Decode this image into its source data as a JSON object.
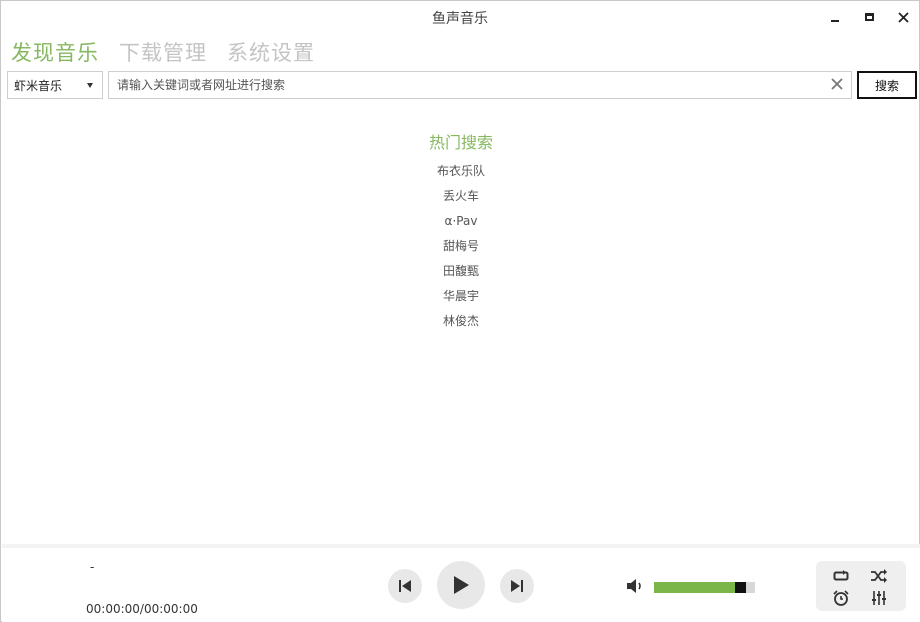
{
  "window": {
    "title": "鱼声音乐"
  },
  "nav": {
    "tabs": [
      {
        "label": "发现音乐",
        "active": true
      },
      {
        "label": "下载管理",
        "active": false
      },
      {
        "label": "系统设置",
        "active": false
      }
    ]
  },
  "search": {
    "source": "虾米音乐",
    "placeholder": "请输入关键词或者网址进行搜索",
    "value": "",
    "button_label": "搜索"
  },
  "hot": {
    "title": "热门搜索",
    "items": [
      "布衣乐队",
      "丢火车",
      "α·Pav",
      "甜梅号",
      "田馥甄",
      "华晨宇",
      "林俊杰"
    ]
  },
  "player": {
    "song_title": "-",
    "time": "00:00:00/00:00:00",
    "volume_fraction": 0.81
  },
  "colors": {
    "accent": "#85b85f",
    "volume": "#7ab648"
  },
  "icons": [
    "minimize-icon",
    "maximize-icon",
    "close-icon",
    "clear-icon",
    "previous-icon",
    "play-icon",
    "next-icon",
    "volume-icon",
    "repeat-icon",
    "shuffle-icon",
    "timer-icon",
    "equalizer-icon"
  ]
}
